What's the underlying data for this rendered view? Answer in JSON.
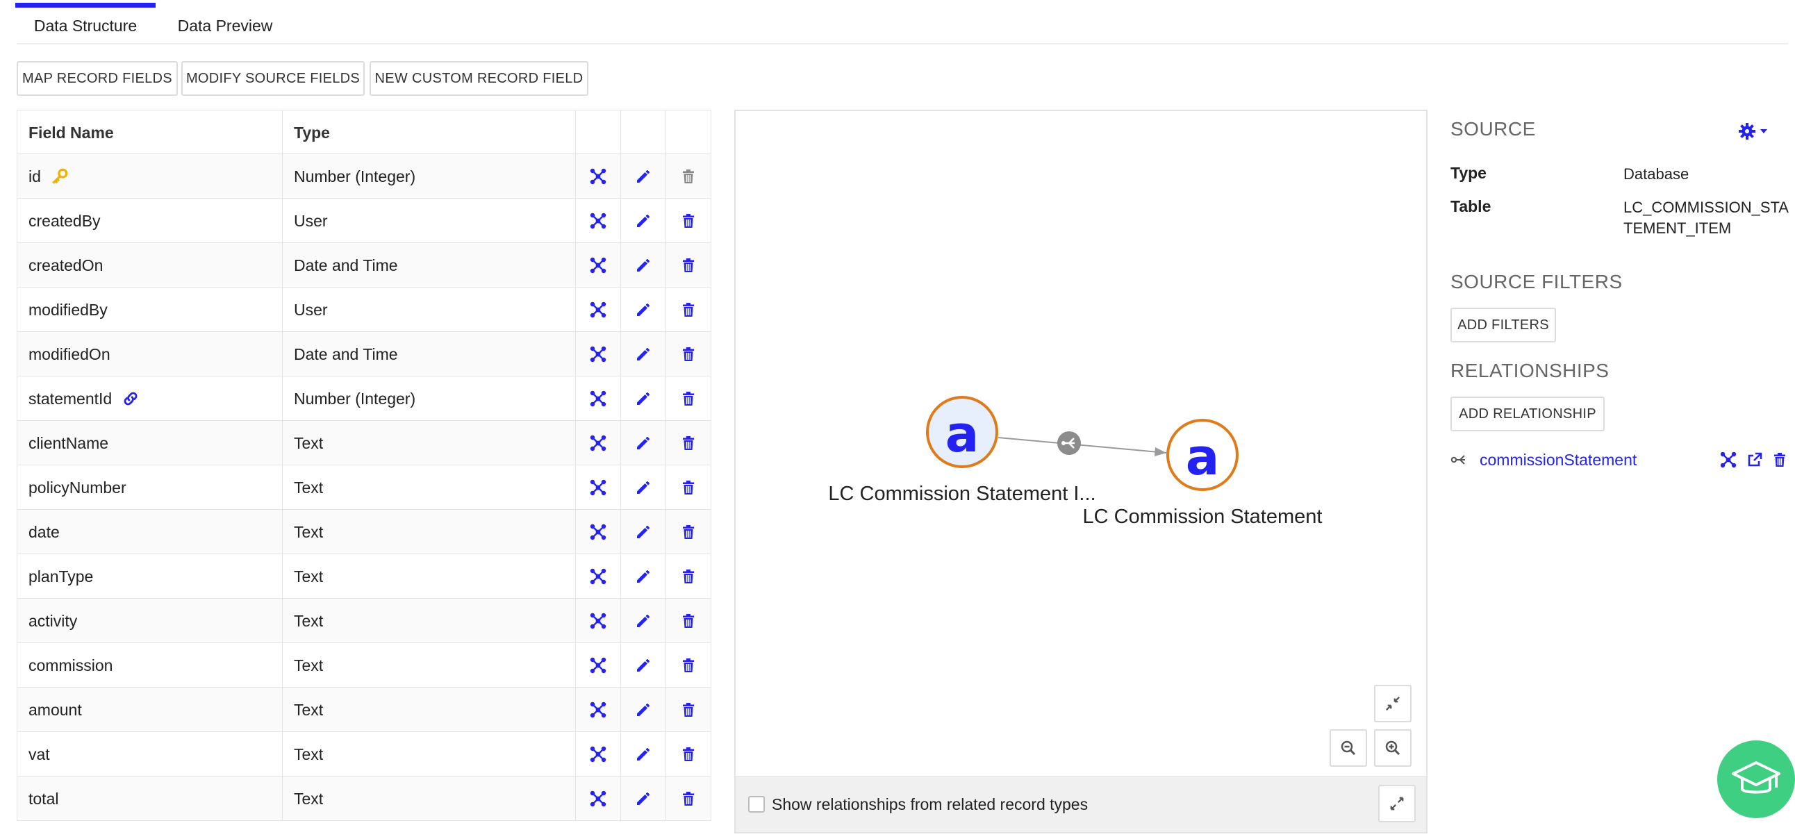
{
  "tabs": [
    {
      "label": "Data Structure",
      "active": true
    },
    {
      "label": "Data Preview",
      "active": false
    }
  ],
  "toolbar": {
    "map_label": "MAP RECORD FIELDS",
    "modify_label": "MODIFY SOURCE FIELDS",
    "new_label": "NEW CUSTOM RECORD FIELD"
  },
  "table": {
    "headers": {
      "name": "Field Name",
      "type": "Type"
    },
    "rows": [
      {
        "name": "id",
        "type": "Number (Integer)",
        "badge": "key-icon"
      },
      {
        "name": "createdBy",
        "type": "User"
      },
      {
        "name": "createdOn",
        "type": "Date and Time"
      },
      {
        "name": "modifiedBy",
        "type": "User"
      },
      {
        "name": "modifiedOn",
        "type": "Date and Time"
      },
      {
        "name": "statementId",
        "type": "Number (Integer)",
        "badge": "link-icon"
      },
      {
        "name": "clientName",
        "type": "Text"
      },
      {
        "name": "policyNumber",
        "type": "Text"
      },
      {
        "name": "date",
        "type": "Text"
      },
      {
        "name": "planType",
        "type": "Text"
      },
      {
        "name": "activity",
        "type": "Text"
      },
      {
        "name": "commission",
        "type": "Text"
      },
      {
        "name": "amount",
        "type": "Text"
      },
      {
        "name": "vat",
        "type": "Text"
      },
      {
        "name": "total",
        "type": "Text"
      }
    ]
  },
  "graph": {
    "node1_label": "LC Commission Statement I...",
    "node2_label": "LC Commission Statement",
    "node_glyph": "a",
    "show_related_label": "Show relationships from related record types"
  },
  "source": {
    "heading": "SOURCE",
    "type_key": "Type",
    "type_value": "Database",
    "table_key": "Table",
    "table_value_line1": "LC_COMMISSION_STA",
    "table_value_line2": "TEMENT_ITEM",
    "filters_heading": "SOURCE FILTERS",
    "add_filters": "ADD FILTERS",
    "relationships_heading": "RELATIONSHIPS",
    "add_relationship": "ADD RELATIONSHIP",
    "relationship_name": "commissionStatement"
  },
  "colors": {
    "accent": "#2322f0",
    "node_ring": "#e07b1a",
    "key": "#f0b400",
    "help": "#3fcf82",
    "disabled": "#888888"
  }
}
